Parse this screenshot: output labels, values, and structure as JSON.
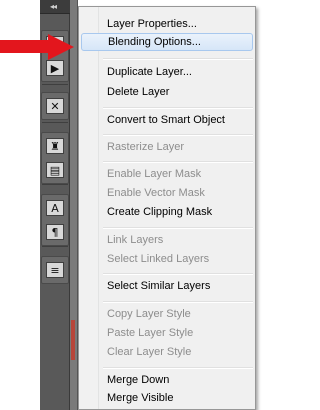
{
  "panel": {
    "collapse_glyph": "◂◂",
    "tools": [
      {
        "icon": "layer-comp-icon",
        "glyph": "▦"
      },
      {
        "icon": "play-action-icon",
        "glyph": "▶"
      },
      {
        "icon": "tools-preset-icon",
        "glyph": "✕"
      },
      {
        "icon": "clone-source-icon",
        "glyph": "♜"
      },
      {
        "icon": "brush-panel-icon",
        "glyph": "▤"
      },
      {
        "icon": "character-panel-icon",
        "glyph": "A"
      },
      {
        "icon": "paragraph-panel-icon",
        "glyph": "¶"
      },
      {
        "icon": "notes-panel-icon",
        "glyph": "≡"
      }
    ]
  },
  "menu": {
    "items": [
      {
        "label": "Layer Properties...",
        "enabled": true
      },
      {
        "label": "Blending Options...",
        "enabled": true,
        "highlighted": true
      },
      {
        "label": "Duplicate Layer...",
        "enabled": true
      },
      {
        "label": "Delete Layer",
        "enabled": true
      },
      {
        "label": "Convert to Smart Object",
        "enabled": true
      },
      {
        "label": "Rasterize Layer",
        "enabled": false
      },
      {
        "label": "Enable Layer Mask",
        "enabled": false
      },
      {
        "label": "Enable Vector Mask",
        "enabled": false
      },
      {
        "label": "Create Clipping Mask",
        "enabled": true
      },
      {
        "label": "Link Layers",
        "enabled": false
      },
      {
        "label": "Select Linked Layers",
        "enabled": false
      },
      {
        "label": "Select Similar Layers",
        "enabled": true
      },
      {
        "label": "Copy Layer Style",
        "enabled": false
      },
      {
        "label": "Paste Layer Style",
        "enabled": false
      },
      {
        "label": "Clear Layer Style",
        "enabled": false
      },
      {
        "label": "Merge Down",
        "enabled": true
      },
      {
        "label": "Merge Visible",
        "enabled": true
      }
    ]
  },
  "colors": {
    "arrow": "#e3161d",
    "highlight_border": "#a8c8ee",
    "disabled_text": "#8d8d8d"
  }
}
